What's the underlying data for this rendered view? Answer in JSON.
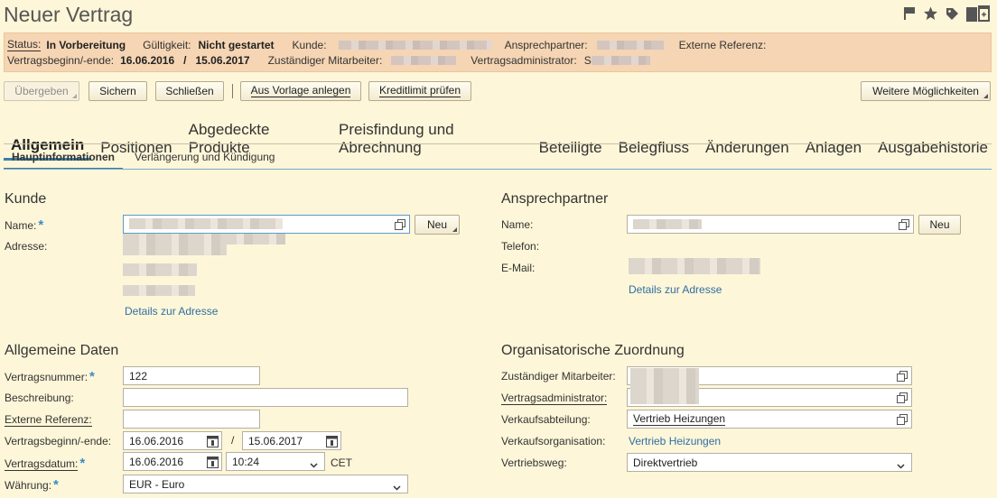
{
  "page": {
    "title": "Neuer Vertrag"
  },
  "header_icons": [
    "flag-icon",
    "star-icon",
    "tag-icon",
    "add-window-icon"
  ],
  "status_bar": {
    "status_label": "Status:",
    "status_value": "In Vorbereitung",
    "validity_label": "Gültigkeit:",
    "validity_value": "Nicht gestartet",
    "customer_label": "Kunde:",
    "contact_label": "Ansprechpartner:",
    "ext_ref_label": "Externe Referenz:",
    "period_label": "Vertragsbeginn/-ende:",
    "period_start": "16.06.2016",
    "period_sep": "/",
    "period_end": "15.06.2017",
    "employee_label": "Zuständiger Mitarbeiter:",
    "admin_label": "Vertragsadministrator:",
    "admin_prefix": "S"
  },
  "toolbar": {
    "submit": "Übergeben",
    "save": "Sichern",
    "close": "Schließen",
    "from_template": "Aus Vorlage anlegen",
    "credit_check": "Kreditlimit prüfen",
    "more": "Weitere Möglichkeiten"
  },
  "tabs": [
    "Allgemein",
    "Positionen",
    "Abgedeckte Produkte",
    "Preisfindung und Abrechnung",
    "Beteiligte",
    "Belegfluss",
    "Änderungen",
    "Anlagen",
    "Ausgabehistorie"
  ],
  "subtabs": [
    "Hauptinformationen",
    "Verlängerung und Kündigung"
  ],
  "customer": {
    "title": "Kunde",
    "name_label": "Name:",
    "address_label": "Adresse:",
    "new_button": "Neu",
    "address_link": "Details zur Adresse"
  },
  "contact": {
    "title": "Ansprechpartner",
    "name_label": "Name:",
    "phone_label": "Telefon:",
    "email_label": "E-Mail:",
    "new_button": "Neu",
    "address_link": "Details zur Adresse"
  },
  "general": {
    "title": "Allgemeine Daten",
    "contract_no_label": "Vertragsnummer:",
    "contract_no": "122",
    "description_label": "Beschreibung:",
    "description": "",
    "ext_ref_label": "Externe Referenz:",
    "ext_ref": "",
    "period_label": "Vertragsbeginn/-ende:",
    "start": "16.06.2016",
    "sep": "/",
    "end": "15.06.2017",
    "date_label": "Vertragsdatum:",
    "date": "16.06.2016",
    "time": "10:24",
    "timezone": "CET",
    "currency_label": "Währung:",
    "currency": "EUR - Euro"
  },
  "org": {
    "title": "Organisatorische Zuordnung",
    "employee_label": "Zuständiger Mitarbeiter:",
    "admin_label": "Vertragsadministrator:",
    "sales_dept_label": "Verkaufsabteilung:",
    "sales_dept": "Vertrieb Heizungen",
    "sales_org_label": "Verkaufsorganisation:",
    "sales_org": "Vertrieb Heizungen",
    "channel_label": "Vertriebsweg:",
    "channel": "Direktvertrieb"
  },
  "colors": {
    "accent": "#3a7fa8",
    "link": "#2f6fa4",
    "status_bg": "#f5d5b3",
    "page_bg": "#fdf6d8",
    "required": "#3a8cc8"
  }
}
